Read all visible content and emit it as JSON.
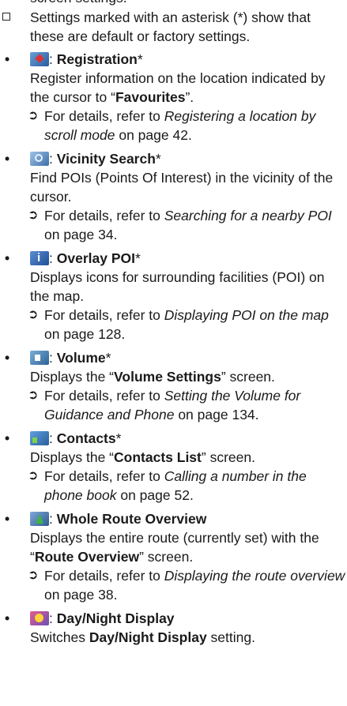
{
  "top_cut_line": "screen settings.",
  "note": "Settings marked with an asterisk (*) show that these are default or factory settings.",
  "bullet": "•",
  "arrow": "➲",
  "colon": ":",
  "asterisk": "*",
  "on_page": "on page",
  "entries": [
    {
      "icon": "registration-icon",
      "title": "Registration",
      "asterisk": true,
      "desc_pre": "Register information on the location indicated by the cursor to “",
      "desc_bold": "Favourites",
      "desc_post": "”.",
      "ref_pre": "For details, refer to ",
      "ref_italic": "Registering a location by scroll mode",
      "ref_page": "42"
    },
    {
      "icon": "vicinity-search-icon",
      "title": "Vicinity Search",
      "asterisk": true,
      "desc_pre": "Find POIs (Points Of Interest) in the vicinity of the cursor.",
      "ref_pre": "For details, refer to ",
      "ref_italic": "Searching for a nearby POI",
      "ref_page": "34"
    },
    {
      "icon": "overlay-poi-icon",
      "title": "Overlay POI",
      "asterisk": true,
      "desc_pre": "Displays icons for surrounding facilities (POI) on the map.",
      "ref_pre": "For details, refer to ",
      "ref_italic": "Displaying POI on the map",
      "ref_page": "128"
    },
    {
      "icon": "volume-icon",
      "title": "Volume",
      "asterisk": true,
      "desc_pre": "Displays the “",
      "desc_bold": "Volume Settings",
      "desc_post": "” screen.",
      "ref_pre": "For details, refer to ",
      "ref_italic": "Setting the Volume for Guidance and Phone",
      "ref_page": "134"
    },
    {
      "icon": "contacts-icon",
      "title": "Contacts",
      "asterisk": true,
      "desc_pre": "Displays the “",
      "desc_bold": "Contacts List",
      "desc_post": "” screen.",
      "ref_pre": "For details, refer to ",
      "ref_italic": "Calling a number in the phone book",
      "ref_page": "52"
    },
    {
      "icon": "whole-route-overview-icon",
      "title": "Whole Route Overview",
      "asterisk": false,
      "desc_pre": "Displays the entire route (currently set) with the “",
      "desc_bold": "Route Overview",
      "desc_post": "” screen.",
      "ref_pre": "For details, refer to ",
      "ref_italic": "Displaying the route overview",
      "ref_page": "38"
    },
    {
      "icon": "day-night-display-icon",
      "title": "Day/Night Display",
      "asterisk": false,
      "desc_pre": "Switches ",
      "desc_bold": "Day/Night Display",
      "desc_post": " setting."
    }
  ]
}
